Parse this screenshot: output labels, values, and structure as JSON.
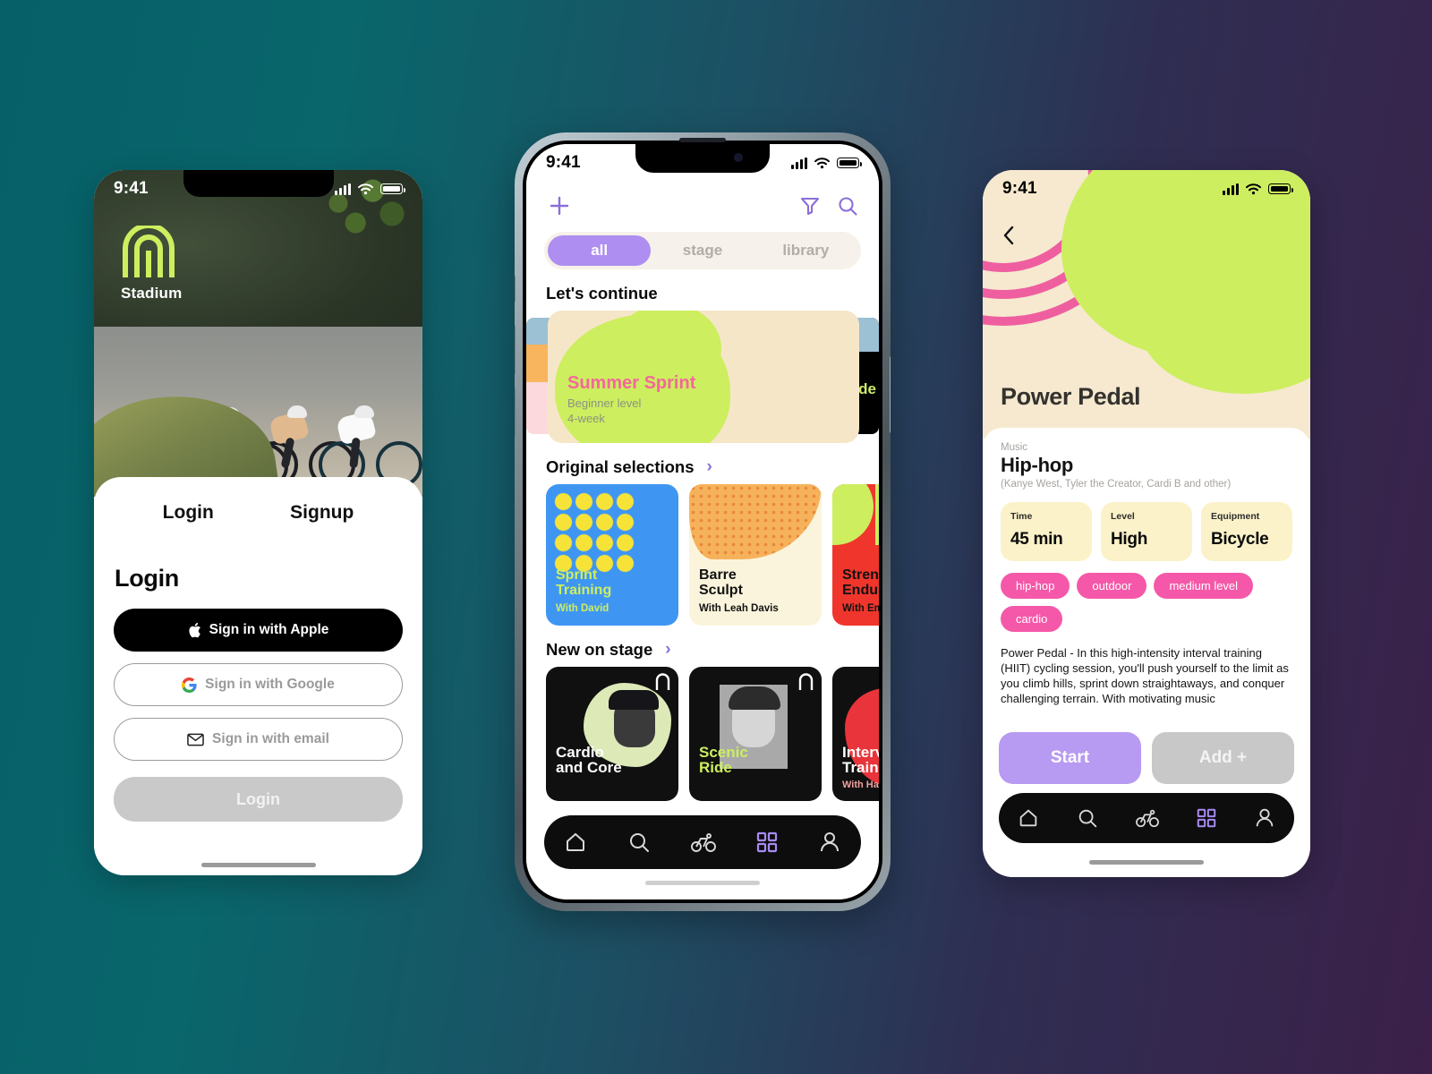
{
  "background": {
    "gradient_from": "#056067",
    "gradient_to": "#3b2049"
  },
  "brand": {
    "name": "Stadium",
    "green": "#cdee5f",
    "pink": "#f558a8",
    "purple": "#ae8ef0"
  },
  "phone1": {
    "status": {
      "time": "9:41",
      "signal_icon": "cellular-bars-icon",
      "wifi_icon": "wifi-icon",
      "battery_icon": "battery-icon"
    },
    "logo_label": "Stadium",
    "tabs": [
      {
        "label": "Login",
        "active": true
      },
      {
        "label": "Signup",
        "active": false
      }
    ],
    "heading": "Login",
    "buttons": [
      {
        "label": "Sign in with Apple",
        "icon": "apple-icon"
      },
      {
        "label": "Sign in with Google",
        "icon": "google-icon"
      },
      {
        "label": "Sign in with email",
        "icon": "envelope-icon"
      }
    ],
    "submit_label": "Login"
  },
  "phone2": {
    "status": {
      "time": "9:41"
    },
    "topbar": {
      "add_icon": "plus-icon",
      "filter_icon": "filter-icon",
      "search_icon": "search-icon"
    },
    "segments": [
      {
        "label": "all",
        "active": true
      },
      {
        "label": "stage",
        "active": false
      },
      {
        "label": "library",
        "active": false
      }
    ],
    "continue": {
      "section_title": "Let's continue",
      "card": {
        "title": "Summer Sprint",
        "level": "Beginner level",
        "duration": "4-week"
      },
      "peek_right_text": "de"
    },
    "originals": {
      "section_title": "Original selections",
      "chevron": "chevron-right-icon",
      "cards": [
        {
          "title": "Sprint\nTraining",
          "subtitle": "With David",
          "bg": "#3f96f2",
          "title_color": "#cdee5f"
        },
        {
          "title": "Barre\nSculpt",
          "subtitle": "With Leah Davis",
          "bg": "#fbf4dc",
          "title_color": "#111111"
        },
        {
          "title": "Strength\nEndurance",
          "subtitle": "With Emma",
          "bg": "#f0362c",
          "title_color": "#111111"
        }
      ]
    },
    "new_on_stage": {
      "section_title": "New on stage",
      "chevron": "chevron-right-icon",
      "cards": [
        {
          "title": "Cardio\nand Core",
          "subtitle": "",
          "badge": "stage"
        },
        {
          "title": "Scenic\nRide",
          "subtitle": "",
          "badge": "stage"
        },
        {
          "title": "Interval\nTraining",
          "subtitle": "With Hannah",
          "badge": "stage"
        }
      ]
    },
    "nav": [
      {
        "icon": "home-icon",
        "active": false
      },
      {
        "icon": "search-icon",
        "active": false
      },
      {
        "icon": "bike-icon",
        "active": false
      },
      {
        "icon": "grid-icon",
        "active": true
      },
      {
        "icon": "person-icon",
        "active": false
      }
    ]
  },
  "phone3": {
    "status": {
      "time": "9:41"
    },
    "back_icon": "chevron-left-icon",
    "title": "Power Pedal",
    "music": {
      "label": "Music",
      "genre": "Hip-hop",
      "artists": "(Kanye West, Tyler the Creator, Cardi B and other)"
    },
    "stats": [
      {
        "key": "Time",
        "value": "45 min"
      },
      {
        "key": "Level",
        "value": "High"
      },
      {
        "key": "Equipment",
        "value": "Bicycle"
      }
    ],
    "tags": [
      "hip-hop",
      "outdoor",
      "medium level",
      "cardio"
    ],
    "description": "Power Pedal - In this high-intensity interval training (HIIT) cycling session, you'll push yourself to the limit as you climb hills, sprint down straightaways, and conquer challenging terrain. With motivating music",
    "actions": [
      {
        "label": "Start"
      },
      {
        "label": "Add +"
      }
    ],
    "nav": [
      {
        "icon": "home-icon",
        "active": false
      },
      {
        "icon": "search-icon",
        "active": false
      },
      {
        "icon": "bike-icon",
        "active": false
      },
      {
        "icon": "grid-icon",
        "active": true
      },
      {
        "icon": "person-icon",
        "active": false
      }
    ]
  }
}
